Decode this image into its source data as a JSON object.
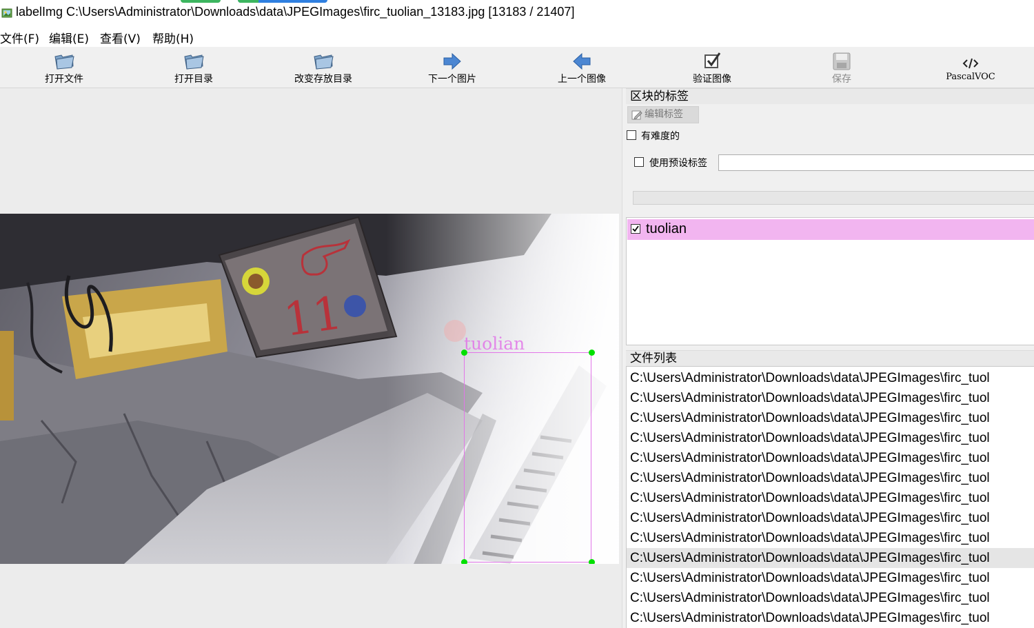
{
  "window": {
    "title": "labelImg C:\\Users\\Administrator\\Downloads\\data\\JPEGImages\\firc_tuolian_13183.jpg [13183 / 21407]"
  },
  "menu": [
    "文件(F)",
    "编辑(E)",
    "查看(V)",
    "帮助(H)"
  ],
  "toolbar": {
    "open_file": "打开文件",
    "open_dir": "打开目录",
    "change_save_dir": "改变存放目录",
    "next_image": "下一个图片",
    "prev_image": "上一个图像",
    "verify_image": "验证图像",
    "save": "保存",
    "format": "PascalVOC"
  },
  "labels_panel": {
    "title": "区块的标签",
    "edit_label": "编辑标签",
    "difficult": "有难度的",
    "use_default_label": "使用预设标签",
    "default_label_value": "",
    "items": [
      {
        "text": "tuolian",
        "checked": true
      }
    ]
  },
  "annotation": {
    "label": "tuolian",
    "color": "#e276e8",
    "vertex_color": "#00e000"
  },
  "file_panel": {
    "title": "文件列表",
    "files": [
      "C:\\Users\\Administrator\\Downloads\\data\\JPEGImages\\firc_tuol",
      "C:\\Users\\Administrator\\Downloads\\data\\JPEGImages\\firc_tuol",
      "C:\\Users\\Administrator\\Downloads\\data\\JPEGImages\\firc_tuol",
      "C:\\Users\\Administrator\\Downloads\\data\\JPEGImages\\firc_tuol",
      "C:\\Users\\Administrator\\Downloads\\data\\JPEGImages\\firc_tuol",
      "C:\\Users\\Administrator\\Downloads\\data\\JPEGImages\\firc_tuol",
      "C:\\Users\\Administrator\\Downloads\\data\\JPEGImages\\firc_tuol",
      "C:\\Users\\Administrator\\Downloads\\data\\JPEGImages\\firc_tuol",
      "C:\\Users\\Administrator\\Downloads\\data\\JPEGImages\\firc_tuol",
      "C:\\Users\\Administrator\\Downloads\\data\\JPEGImages\\firc_tuol",
      "C:\\Users\\Administrator\\Downloads\\data\\JPEGImages\\firc_tuol",
      "C:\\Users\\Administrator\\Downloads\\data\\JPEGImages\\firc_tuol",
      "C:\\Users\\Administrator\\Downloads\\data\\JPEGImages\\firc_tuol"
    ],
    "selected_index": 9
  },
  "photo_sign_text": "11"
}
